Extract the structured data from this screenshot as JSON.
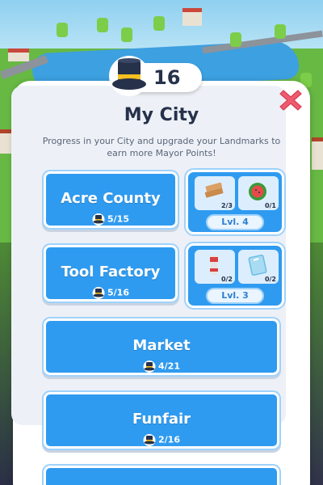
{
  "header": {
    "mayor_points": "16",
    "icon": "top-hat-icon"
  },
  "title": "My City",
  "subtitle": "Progress in your City and upgrade your Landmarks to earn more Mayor Points!",
  "landmarks": [
    {
      "name": "Acre County",
      "progress": "5/15",
      "level": "Lvl. 4",
      "resources": [
        {
          "icon": "wood-planks-icon",
          "count": "2/3"
        },
        {
          "icon": "watermelon-icon",
          "count": "0/1"
        }
      ]
    },
    {
      "name": "Tool Factory",
      "progress": "5/16",
      "level": "Lvl. 3",
      "resources": [
        {
          "icon": "pipe-tool-icon",
          "count": "0/2"
        },
        {
          "icon": "glass-pane-icon",
          "count": "0/2"
        }
      ]
    },
    {
      "name": "Market",
      "progress": "4/21"
    },
    {
      "name": "Funfair",
      "progress": "2/16"
    }
  ],
  "colors": {
    "button_blue": "#2f9bf0",
    "close_red": "#f05a6e",
    "title_text": "#26314a"
  }
}
